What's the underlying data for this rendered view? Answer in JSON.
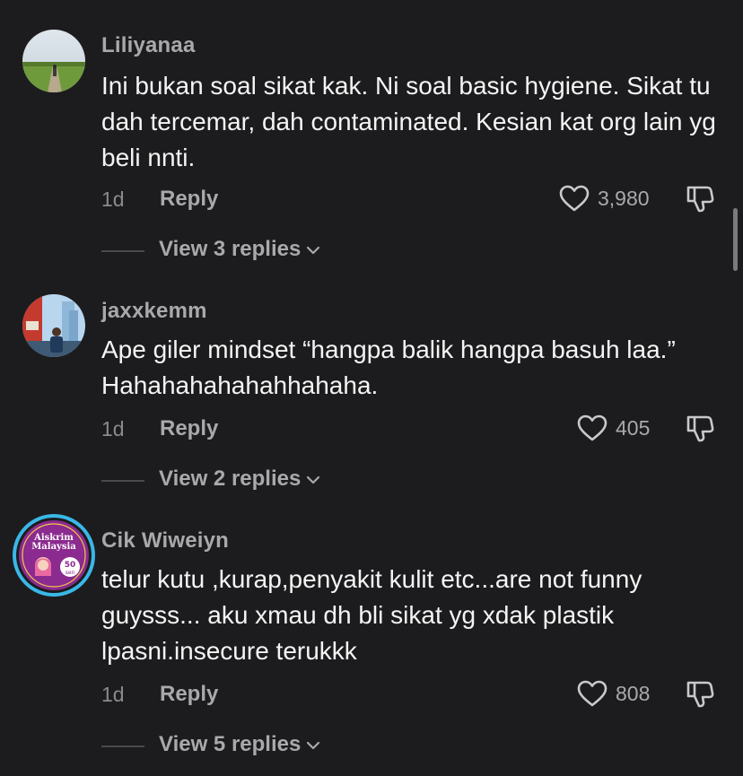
{
  "comments": [
    {
      "username": "Liliyanaa",
      "text": "Ini bukan soal sikat kak. Ni soal basic hygiene. Sikat tu dah tercemar, dah contaminated. Kesian kat org lain yg beli nnti.",
      "time": "1d",
      "reply_label": "Reply",
      "likes": "3,980",
      "view_replies": "View 3 replies"
    },
    {
      "username": "jaxxkemm",
      "text": "Ape giler mindset “hangpa balik hangpa basuh laa.” Hahahahahahahhahaha.",
      "time": "1d",
      "reply_label": "Reply",
      "likes": "405",
      "view_replies": "View 2 replies"
    },
    {
      "username": "Cik Wiweiyn",
      "text": "telur kutu ,kurap,penyakit kulit etc...are not funny guysss... aku xmau dh bli sikat yg xdak plastik lpasni.insecure terukkk",
      "time": "1d",
      "reply_label": "Reply",
      "likes": "808",
      "view_replies": "View 5 replies",
      "avatar_text": {
        "line1": "Aiskrim",
        "line2": "Malaysia",
        "price": "50",
        "unit": "sen"
      }
    }
  ],
  "colors": {
    "background": "#1c1c1e",
    "primary_text": "#f4f4f4",
    "secondary_text": "#a9a9ad",
    "avatar_ring": "#39b8e8"
  },
  "icons": [
    "heart-outline-icon",
    "thumbs-down-icon",
    "chevron-down-icon"
  ]
}
